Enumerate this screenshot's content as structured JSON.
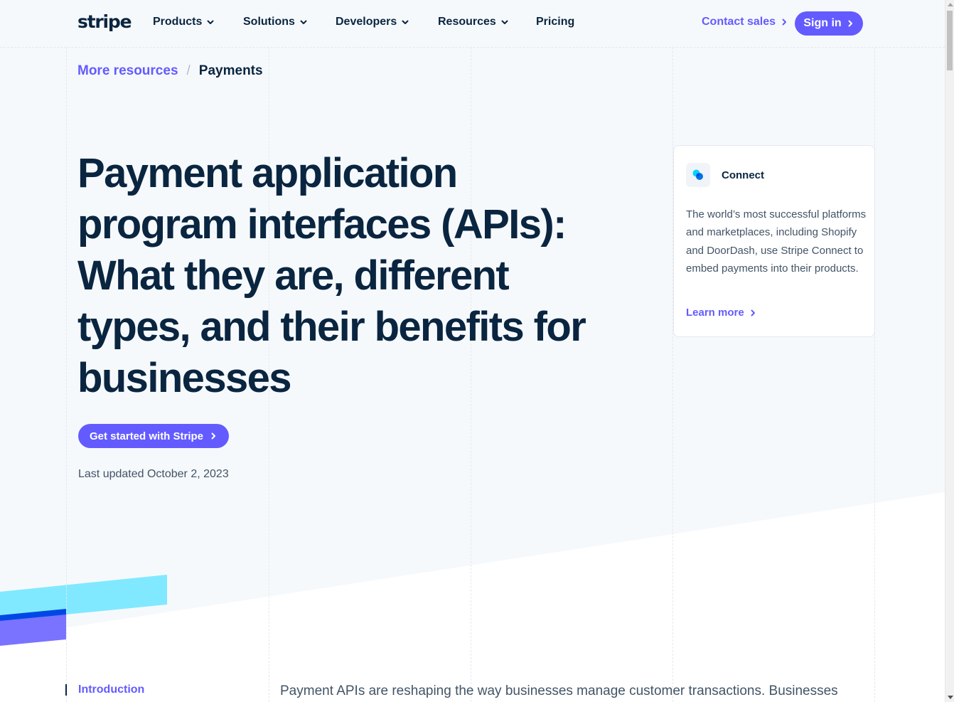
{
  "nav": {
    "logo": "stripe",
    "items": [
      {
        "label": "Products",
        "has_dropdown": true
      },
      {
        "label": "Solutions",
        "has_dropdown": true
      },
      {
        "label": "Developers",
        "has_dropdown": true
      },
      {
        "label": "Resources",
        "has_dropdown": true
      },
      {
        "label": "Pricing",
        "has_dropdown": false
      }
    ],
    "contact_sales": "Contact sales",
    "sign_in": "Sign in"
  },
  "breadcrumb": {
    "parent": "More resources",
    "separator": "/",
    "current": "Payments"
  },
  "article": {
    "title": "Payment application program interfaces (APIs): What they are, different types, and their benefits for businesses",
    "cta": "Get started with Stripe",
    "last_updated": "Last updated October 2, 2023"
  },
  "card": {
    "icon": "connect-icon",
    "title": "Connect",
    "body": "The world’s most successful platforms and marketplaces, including Shopify and DoorDash, use Stripe Connect to embed payments into their products.",
    "link": "Learn more"
  },
  "toc": {
    "active_item": "Introduction"
  },
  "intro_text": "Payment APIs are reshaping the way businesses manage customer transactions. Businesses",
  "colors": {
    "accent": "#635bff",
    "navy": "#0a2540",
    "body_text": "#425466",
    "background": "#f6f9fc",
    "stripe_cyan": "#80e9ff",
    "stripe_blue": "#0048e5",
    "stripe_purple": "#7a73ff"
  }
}
